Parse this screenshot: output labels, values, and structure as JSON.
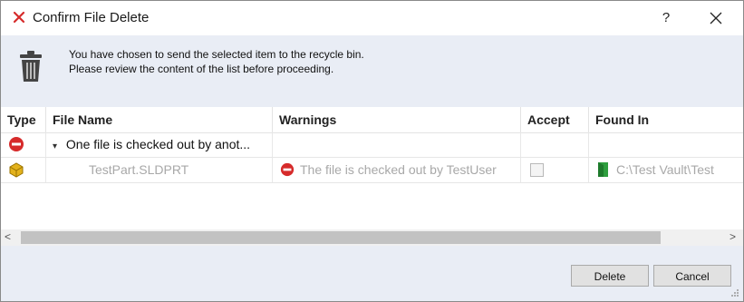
{
  "window": {
    "title": "Confirm File Delete",
    "help_label": "?",
    "close_label": "✕"
  },
  "info": {
    "line1": "You have chosen to send the selected item to the recycle bin.",
    "line2": "Please review the content of the list before proceeding."
  },
  "table": {
    "columns": [
      "Type",
      "File Name",
      "Warnings",
      "Accept",
      "Found In"
    ],
    "group_row": {
      "expand_glyph": "▾",
      "label": "One file is checked out by anot..."
    },
    "file_row": {
      "file_name": "TestPart.SLDPRT",
      "warning": "The file is checked out by TestUser",
      "found_in": "C:\\Test Vault\\Test"
    }
  },
  "scrollbar": {
    "left_arrow": "<",
    "right_arrow": ">"
  },
  "buttons": {
    "delete": "Delete",
    "cancel": "Cancel"
  },
  "colors": {
    "info_band": "#e9edf5",
    "stop_red": "#d62b2b",
    "folder_green": "#2e9e3e",
    "part_yellow": "#e3b21c"
  }
}
